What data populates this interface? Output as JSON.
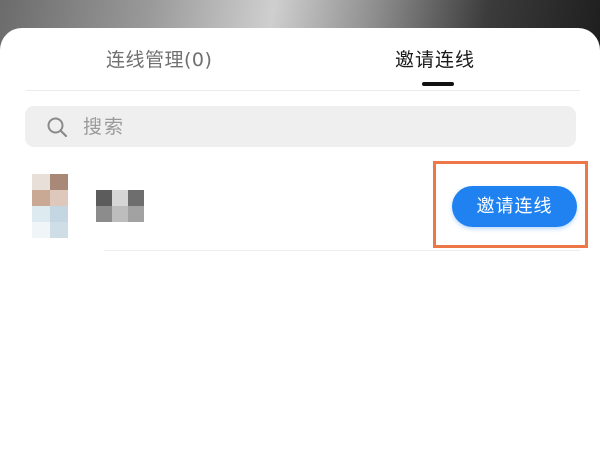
{
  "tabs": {
    "manage_label": "连线管理(0)",
    "invite_label": "邀请连线"
  },
  "search": {
    "placeholder": "搜索",
    "icon": "search-icon"
  },
  "contacts": [
    {
      "name_pixelated": true,
      "avatar_pixelated": true,
      "action_label": "邀请连线"
    }
  ],
  "colors": {
    "accent": "#1f82f0",
    "highlight_border": "#ee7748",
    "active_tab_text": "#1a1a1a",
    "inactive_tab_text": "#707070",
    "search_bg": "#efefef"
  }
}
